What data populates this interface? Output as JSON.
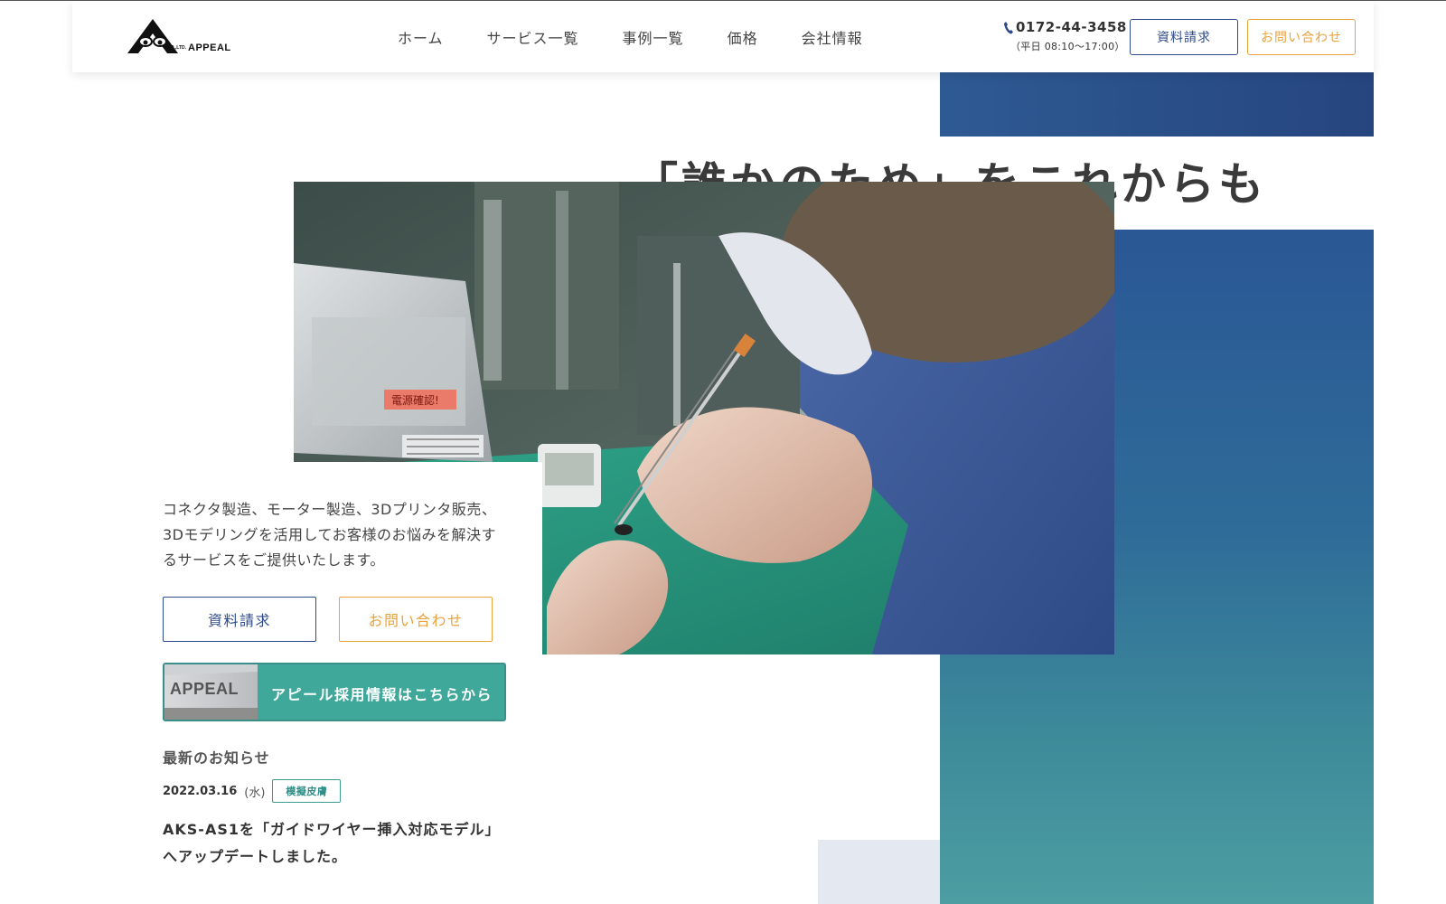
{
  "header": {
    "logo": {
      "name": "APPEAL",
      "small": "CO.,LTD."
    },
    "nav": [
      "ホーム",
      "サービス一覧",
      "事例一覧",
      "価格",
      "会社情報"
    ],
    "phone": "0172-44-3458",
    "hours": "（平日 08:10〜17:00）",
    "doc_button": "資料請求",
    "contact_button": "お問い合わせ"
  },
  "hero": {
    "headline": "「誰かのため」をこれからも",
    "description": "コネクタ製造、モーター製造、3Dプリンタ販売、3Dモデリングを活用してお客様のお悩みを解決するサービスをご提供いたします。",
    "doc_button": "資料請求",
    "contact_button": "お問い合わせ",
    "recruit_banner": "アピール採用情報はこちらから",
    "recruit_thumb_text": "APPEAL",
    "photo_label": "電源確認!"
  },
  "news": {
    "heading": "最新のお知らせ",
    "items": [
      {
        "date": "2022.03.16",
        "weekday": "(水)",
        "tag": "模擬皮膚",
        "title": "AKS-AS1を「ガイドワイヤー挿入対応モデル」へアップデートしました。"
      }
    ]
  },
  "colors": {
    "navy": "#2d4a8a",
    "orange": "#e8a23c",
    "teal": "#3fa89a"
  }
}
